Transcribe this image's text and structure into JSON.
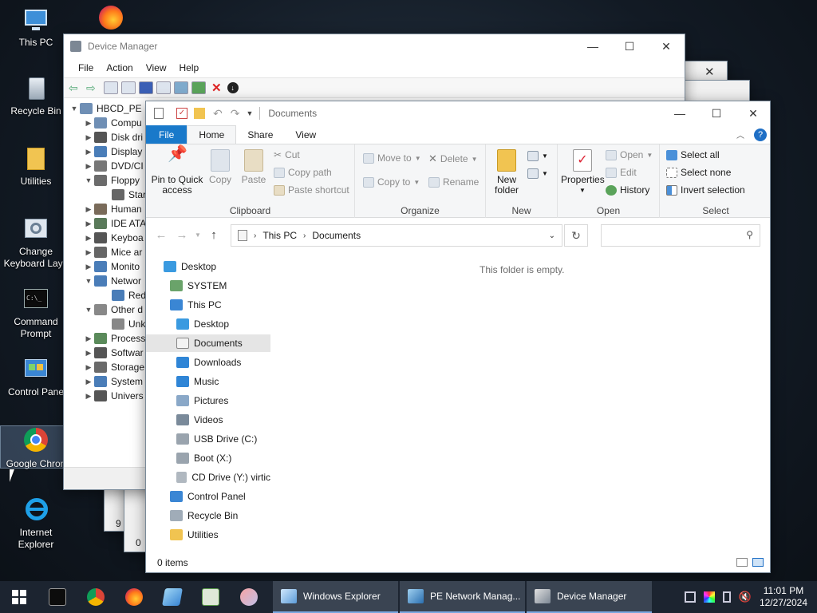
{
  "desktop": {
    "icons": [
      {
        "label": "This PC"
      },
      {
        "label": "Recycle Bin"
      },
      {
        "label": "Utilities"
      },
      {
        "label": "Change Keyboard Layo"
      },
      {
        "label": "Command Prompt"
      },
      {
        "label": "Control Pane"
      },
      {
        "label": "Google Chron"
      },
      {
        "label": "Internet Explorer"
      }
    ]
  },
  "background_windows": {
    "items_count": "9 items",
    "items_count2": "0"
  },
  "device_manager": {
    "title": "Device Manager",
    "menu": [
      "File",
      "Action",
      "View",
      "Help"
    ],
    "root": "HBCD_PE",
    "tree": [
      {
        "label": "Compu",
        "expanded": false
      },
      {
        "label": "Disk dri",
        "expanded": false
      },
      {
        "label": "Display",
        "expanded": false
      },
      {
        "label": "DVD/CI",
        "expanded": false
      },
      {
        "label": "Floppy",
        "expanded": true
      },
      {
        "label": "Star",
        "child": true
      },
      {
        "label": "Human",
        "expanded": false
      },
      {
        "label": "IDE ATA",
        "expanded": false
      },
      {
        "label": "Keyboa",
        "expanded": false
      },
      {
        "label": "Mice ar",
        "expanded": false
      },
      {
        "label": "Monito",
        "expanded": false
      },
      {
        "label": "Networ",
        "expanded": true
      },
      {
        "label": "Red",
        "child": true
      },
      {
        "label": "Other d",
        "expanded": true
      },
      {
        "label": "Unk",
        "child": true
      },
      {
        "label": "Process",
        "expanded": false
      },
      {
        "label": "Softwar",
        "expanded": false
      },
      {
        "label": "Storage",
        "expanded": false
      },
      {
        "label": "System",
        "expanded": false
      },
      {
        "label": "Univers",
        "expanded": false
      }
    ]
  },
  "explorer": {
    "title": "Documents",
    "tabs": {
      "file": "File",
      "home": "Home",
      "share": "Share",
      "view": "View"
    },
    "ribbon": {
      "clipboard": {
        "label": "Clipboard",
        "pin": "Pin to Quick access",
        "copy": "Copy",
        "paste": "Paste",
        "cut": "Cut",
        "copy_path": "Copy path",
        "paste_shortcut": "Paste shortcut"
      },
      "organize": {
        "label": "Organize",
        "move_to": "Move to",
        "copy_to": "Copy to",
        "delete": "Delete",
        "rename": "Rename"
      },
      "new": {
        "label": "New",
        "new_folder": "New folder"
      },
      "open": {
        "label": "Open",
        "properties": "Properties",
        "open": "Open",
        "edit": "Edit",
        "history": "History"
      },
      "select": {
        "label": "Select",
        "select_all": "Select all",
        "select_none": "Select none",
        "invert": "Invert selection"
      }
    },
    "address": {
      "this_pc": "This PC",
      "documents": "Documents"
    },
    "empty_message": "This folder is empty.",
    "nav": [
      {
        "label": "Desktop"
      },
      {
        "label": "SYSTEM"
      },
      {
        "label": "This PC"
      },
      {
        "label": "Desktop"
      },
      {
        "label": "Documents"
      },
      {
        "label": "Downloads"
      },
      {
        "label": "Music"
      },
      {
        "label": "Pictures"
      },
      {
        "label": "Videos"
      },
      {
        "label": "USB Drive (C:)"
      },
      {
        "label": "Boot (X:)"
      },
      {
        "label": "CD Drive (Y:) virtic"
      },
      {
        "label": "Control Panel"
      },
      {
        "label": "Recycle Bin"
      },
      {
        "label": "Utilities"
      }
    ],
    "status": "0 items"
  },
  "taskbar": {
    "tasks": [
      {
        "label": "Windows Explorer"
      },
      {
        "label": "PE Network Manag..."
      },
      {
        "label": "Device Manager"
      }
    ],
    "clock_time": "11:01 PM",
    "clock_date": "12/27/2024"
  }
}
